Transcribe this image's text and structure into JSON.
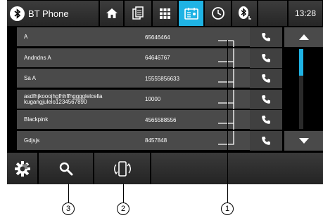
{
  "topbar": {
    "title": "BT Phone",
    "clock": "13:28",
    "icons": [
      "bluetooth-icon",
      "home-icon",
      "phonebook-icon",
      "keypad-icon",
      "contacts-icon",
      "recent-calls-icon",
      "bluetooth-settings-icon"
    ],
    "active_tab": "contacts-icon",
    "accent_color": "#1fb3e4"
  },
  "contacts": [
    {
      "name": "A",
      "number": "65646464"
    },
    {
      "name": "Andndns A",
      "number": "64646767"
    },
    {
      "name": "Sa A",
      "number": "15555856633"
    },
    {
      "name": "asdfhjkooojhgfhhffhgggglelcella kugangjulelo1234567890",
      "number": "10000"
    },
    {
      "name": "Blackpink",
      "number": "4565588556"
    },
    {
      "name": "Gdjsjs",
      "number": "8457848"
    }
  ],
  "scrollbar": {
    "position": 0.0
  },
  "bottombar": {
    "icons": [
      "settings-icon",
      "search-icon",
      "phone-sync-icon"
    ]
  },
  "callouts": [
    "1",
    "2",
    "3"
  ]
}
